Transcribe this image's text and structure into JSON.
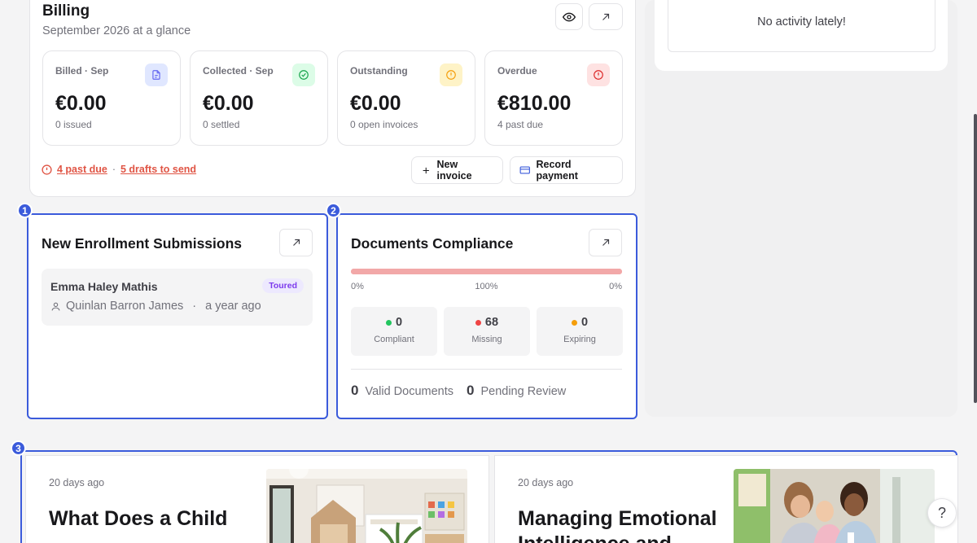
{
  "billing": {
    "title": "Billing",
    "subtitle": "September 2026 at a glance",
    "stats": [
      {
        "label": "Billed · Sep",
        "value": "€0.00",
        "sub": "0 issued",
        "icon": "document-icon",
        "color": "#6366f1",
        "bg": "#e0e7ff"
      },
      {
        "label": "Collected · Sep",
        "value": "€0.00",
        "sub": "0 settled",
        "icon": "check-circle-icon",
        "color": "#16a34a",
        "bg": "#dcfce7"
      },
      {
        "label": "Outstanding",
        "value": "€0.00",
        "sub": "0 open invoices",
        "icon": "clock-alert-icon",
        "color": "#f59e0b",
        "bg": "#fef3c7"
      },
      {
        "label": "Overdue",
        "value": "€810.00",
        "sub": "4 past due",
        "icon": "alert-circle-icon",
        "color": "#dc2626",
        "bg": "#fee2e2"
      }
    ],
    "alert": {
      "past_due": "4 past due",
      "separator": "·",
      "drafts": "5 drafts to send",
      "color": "#e05545"
    },
    "new_invoice_label": "New invoice",
    "record_payment_label": "Record payment"
  },
  "activity": {
    "empty_text": "No activity lately!"
  },
  "enrollment": {
    "badge": "1",
    "title": "New Enrollment Submissions",
    "submissions": [
      {
        "child": "Emma Haley Mathis",
        "status": "Toured",
        "parent": "Quinlan Barron James",
        "separator": "·",
        "time": "a year ago"
      }
    ]
  },
  "documents": {
    "badge": "2",
    "title": "Documents Compliance",
    "progress_labels": [
      "0%",
      "100%",
      "0%"
    ],
    "missing_fraction": 1.0,
    "stats": [
      {
        "value": "0",
        "label": "Compliant",
        "dot": "#22c55e"
      },
      {
        "value": "68",
        "label": "Missing",
        "dot": "#ef4444"
      },
      {
        "value": "0",
        "label": "Expiring",
        "dot": "#f59e0b"
      }
    ],
    "valid_count": "0",
    "valid_label": "Valid Documents",
    "pending_count": "0",
    "pending_label": "Pending Review"
  },
  "articles": {
    "badge": "3",
    "items": [
      {
        "date": "20 days ago",
        "title": "What Does a Child"
      },
      {
        "date": "20 days ago",
        "title": "Managing Emotional Intelligence and"
      }
    ]
  },
  "help_label": "?",
  "accent": "#3b5bdb"
}
